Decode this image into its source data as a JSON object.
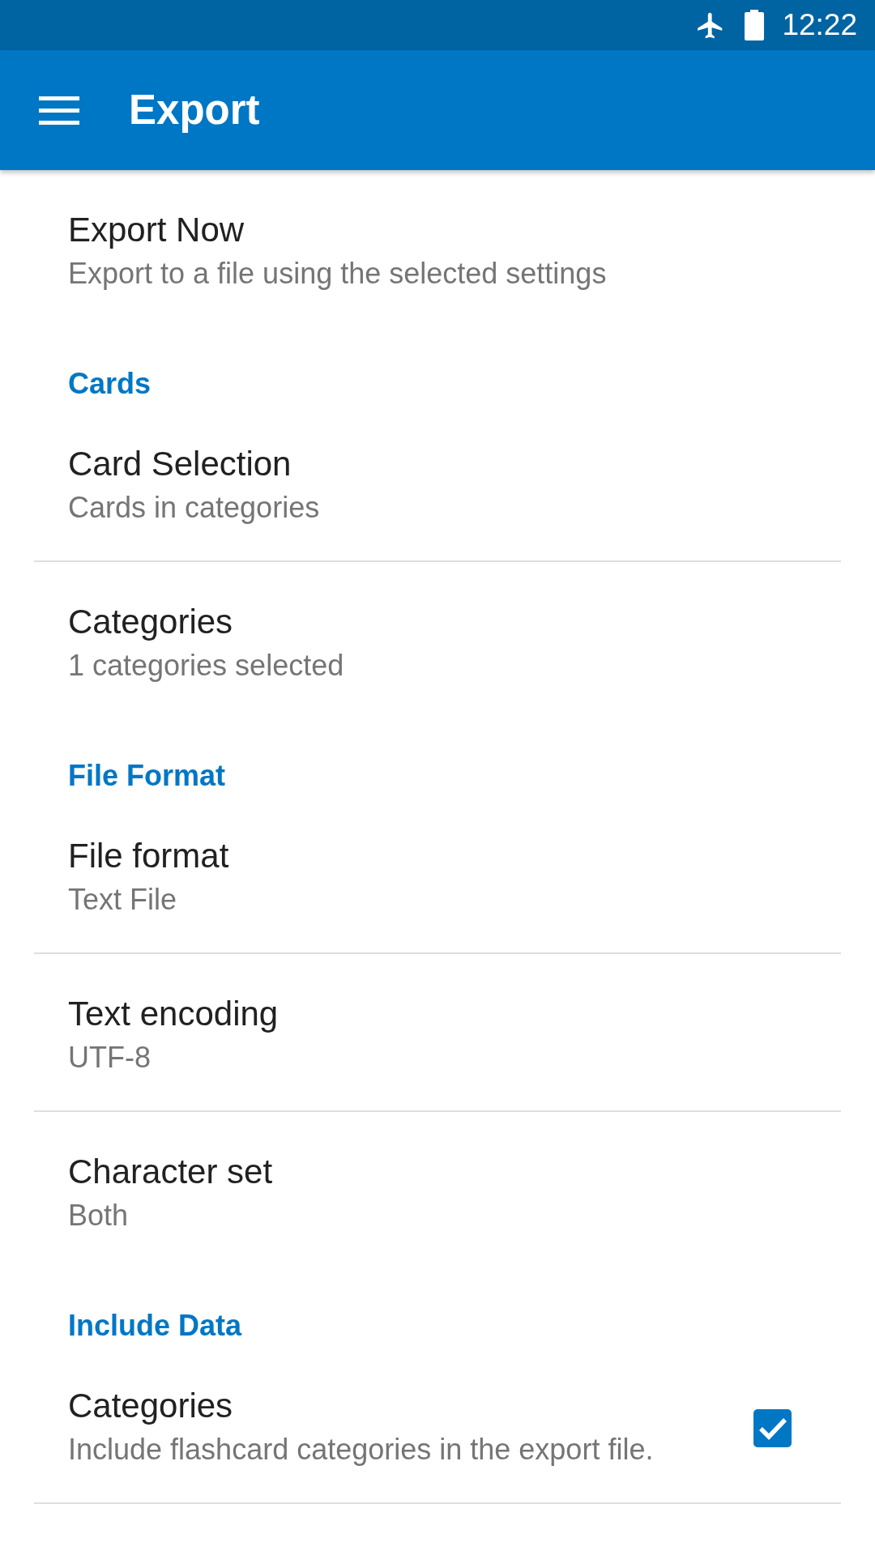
{
  "status_bar": {
    "time": "12:22"
  },
  "app_bar": {
    "title": "Export"
  },
  "sections": [
    {
      "items": [
        {
          "kind": "plain",
          "title": "Export Now",
          "summary": "Export to a file using the selected settings"
        }
      ]
    },
    {
      "header": "Cards",
      "items": [
        {
          "kind": "plain",
          "title": "Card Selection",
          "summary": "Cards in categories"
        },
        {
          "kind": "plain",
          "title": "Categories",
          "summary": "1 categories selected"
        }
      ]
    },
    {
      "header": "File Format",
      "items": [
        {
          "kind": "plain",
          "title": "File format",
          "summary": "Text File"
        },
        {
          "kind": "plain",
          "title": "Text encoding",
          "summary": "UTF-8"
        },
        {
          "kind": "plain",
          "title": "Character set",
          "summary": "Both"
        }
      ]
    },
    {
      "header": "Include Data",
      "items": [
        {
          "kind": "checkbox",
          "title": "Categories",
          "summary": "Include flashcard categories in the export file.",
          "checked": true
        }
      ]
    }
  ]
}
